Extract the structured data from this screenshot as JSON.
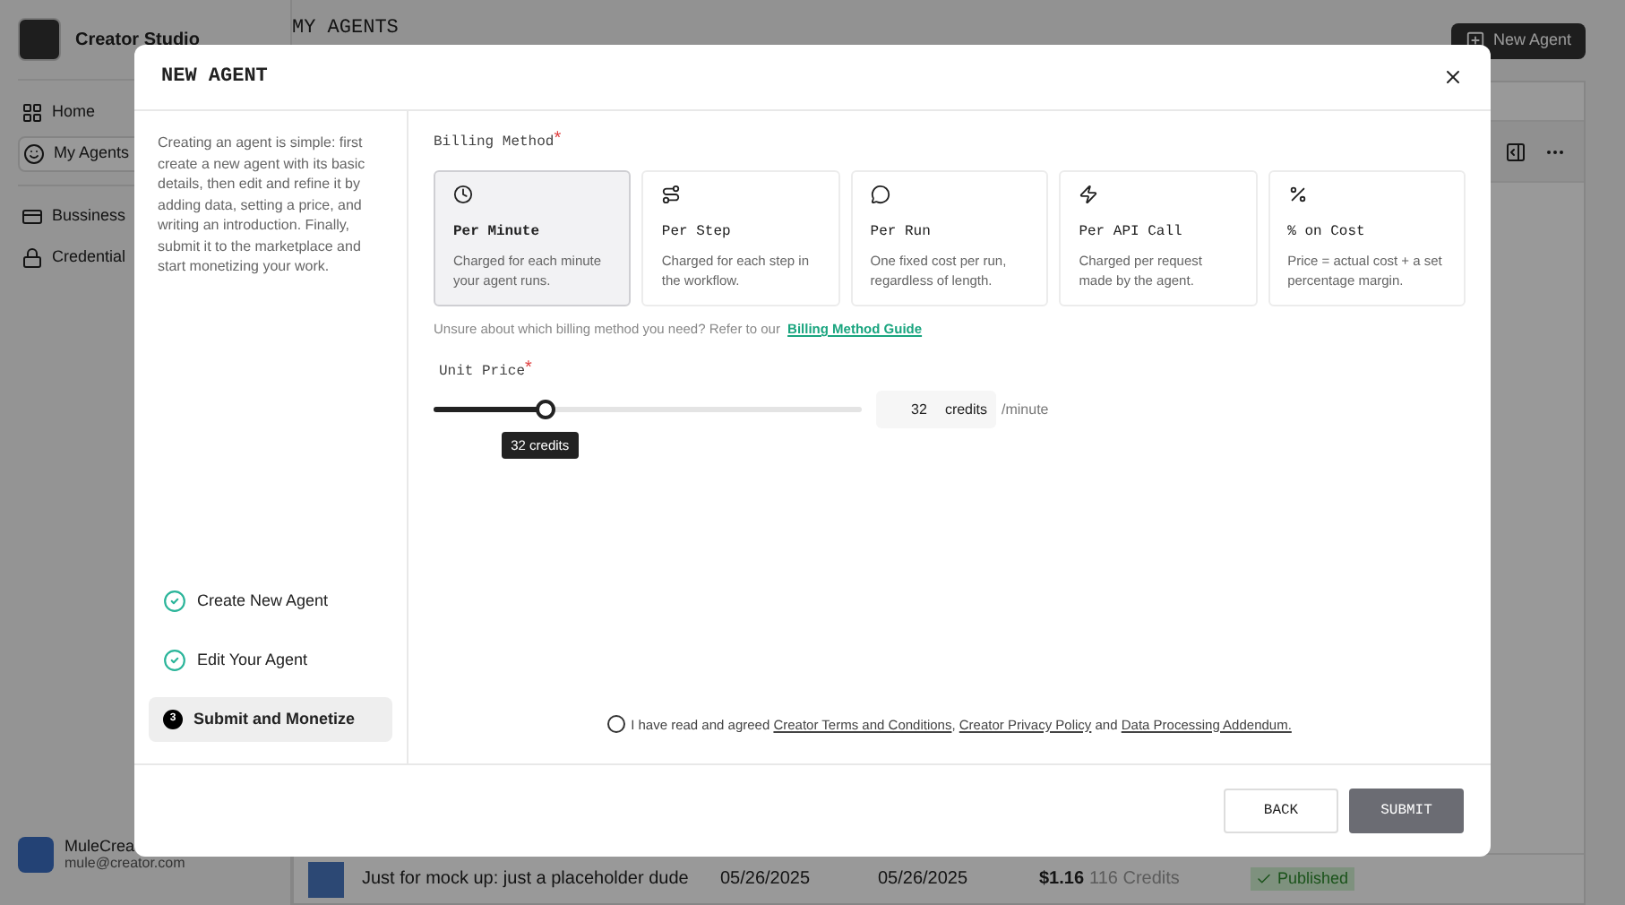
{
  "app": {
    "name": "Creator Studio",
    "nav": [
      {
        "label": "Home",
        "selected": false
      },
      {
        "label": "My Agents",
        "selected": true
      },
      {
        "label": "Bussiness",
        "selected": false
      },
      {
        "label": "Credential",
        "selected": false
      }
    ],
    "user": {
      "name": "MuleCrea",
      "email": "mule@creator.com"
    }
  },
  "page": {
    "title": "MY AGENTS",
    "new_button": "New Agent",
    "row": {
      "title": "Just for mock up: just a placeholder dude",
      "created": "05/26/2025",
      "updated": "05/26/2025",
      "price": "$1.16",
      "credits": "116 Credits",
      "status": "Published"
    }
  },
  "modal": {
    "title": "NEW AGENT",
    "intro": "Creating an agent is simple: first create a new agent with its basic details, then edit and refine it by adding data, setting a price, and writing an introduction. Finally, submit it to the marketplace and start monetizing your work.",
    "steps": [
      {
        "label": "Create New Agent",
        "done": true,
        "selected": false
      },
      {
        "label": "Edit Your Agent",
        "done": true,
        "selected": false
      },
      {
        "label": "Submit and Monetize",
        "done": false,
        "selected": true,
        "number": "3"
      }
    ],
    "billing_label": "Billing Method",
    "billing_required_mark": "*",
    "methods": [
      {
        "title": "Per Minute",
        "description": "Charged for each minute your agent runs.",
        "selected": true
      },
      {
        "title": "Per Step",
        "description": "Charged for each step in the workflow.",
        "selected": false
      },
      {
        "title": "Per Run",
        "description": "One fixed cost per run, regardless of length.",
        "selected": false
      },
      {
        "title": "Per API Call",
        "description": "Charged per request made by the agent.",
        "selected": false
      },
      {
        "title": "% on Cost",
        "description": "Price = actual cost + a set percentage margin.",
        "selected": false
      }
    ],
    "hint": "Unsure about which billing method you need? Refer to our",
    "hint_link": "Billing Method Guide",
    "price_label": "Unit Price",
    "price_required_mark": "*",
    "slider": {
      "level": 0.26,
      "tooltip": "32 credits"
    },
    "price_value": "32",
    "price_unit": "credits",
    "price_suffix": "/minute",
    "agreement": {
      "checked": false,
      "parts": [
        {
          "kind": "text",
          "text": "I have read and agreed "
        },
        {
          "kind": "link",
          "text": "Creator Terms and Conditions"
        },
        {
          "kind": "text",
          "text": ", "
        },
        {
          "kind": "link",
          "text": "Creator Privacy Policy"
        },
        {
          "kind": "text",
          "text": " and "
        },
        {
          "kind": "link",
          "text": "Data Processing Addendum."
        }
      ]
    },
    "buttons": {
      "back": "BACK",
      "submit": "SUBMIT"
    }
  }
}
